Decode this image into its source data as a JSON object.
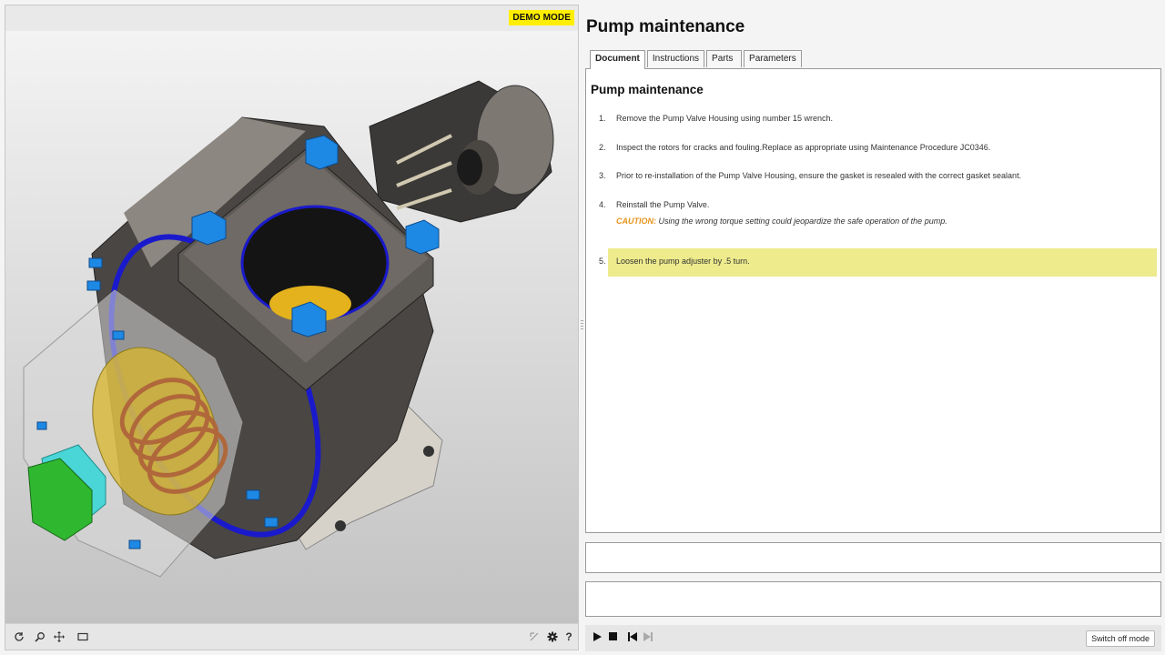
{
  "viewer": {
    "badge": "DEMO MODE",
    "toolbar": {
      "left_icons": [
        "rotate-icon",
        "zoom-icon",
        "pan-icon",
        "frame-icon"
      ],
      "right_icons": [
        "reset-view-icon",
        "gear-icon",
        "help-icon"
      ],
      "help_label": "?"
    }
  },
  "document": {
    "title": "Pump maintenance",
    "tabs": [
      {
        "label": "Document",
        "active": true
      },
      {
        "label": "Instructions",
        "active": false
      },
      {
        "label": "Parts",
        "active": false
      },
      {
        "label": "Parameters",
        "active": false
      }
    ],
    "heading": "Pump maintenance",
    "steps": [
      {
        "num": "1.",
        "text": "Remove the Pump Valve Housing using number 15 wrench."
      },
      {
        "num": "2.",
        "text": "Inspect the rotors for cracks and fouling.Replace as appropriate using Maintenance Procedure JC0346."
      },
      {
        "num": "3.",
        "text": "Prior to re-installation of the Pump Valve Housing, ensure the gasket is resealed with the correct gasket sealant."
      },
      {
        "num": "4.",
        "text": "Reinstall the Pump Valve.",
        "caution_label": "CAUTION:",
        "caution_text": " Using the wrong torque setting could jeopardize the safe operation of the pump."
      },
      {
        "num": "5.",
        "text": "Loosen the pump adjuster by .5 turn.",
        "highlighted": true
      }
    ]
  },
  "player": {
    "icons": [
      "play-icon",
      "stop-icon",
      "skip-back-icon",
      "skip-forward-icon"
    ],
    "switch_label": "Switch off mode"
  },
  "colors": {
    "badge": "#ffee00",
    "highlight": "#edeb8c",
    "caution": "#e8931c",
    "bolt_blue": "#1e88e5",
    "housing_dark": "#3b3937"
  }
}
